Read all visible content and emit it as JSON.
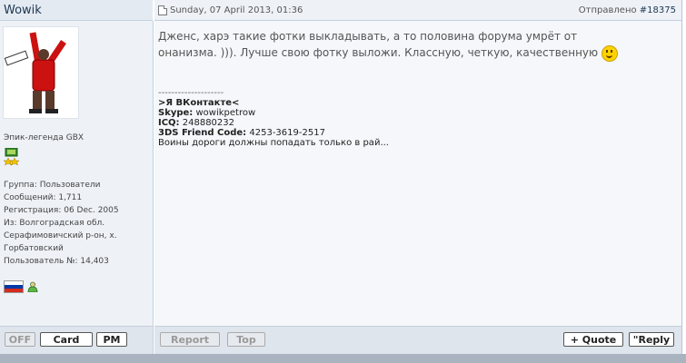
{
  "post": {
    "author": "Wowik",
    "date": "Sunday, 07 April 2013, 01:36",
    "sent_label": "Отправлено",
    "post_number": "#18375"
  },
  "profile": {
    "rank": "Эпик-легенда GBX",
    "info": [
      "Группа: Пользователи",
      "Сообщений: 1,711",
      "Регистрация: 06 Dec. 2005",
      "Из: Волгоградская обл.",
      "Серафимовичский р-он, х.",
      "Горбатовский",
      "Пользователь №: 14,403"
    ],
    "flag_colors": [
      "#ffffff",
      "#0039a6",
      "#d52b1e"
    ]
  },
  "message": {
    "text": "Дженс, харэ такие фотки выкладывать, а то половина форума умрёт от онанизма. ))). Лучше свою фотку выложи. Классную, четкую, качественную",
    "smile_icon": "smile-icon"
  },
  "signature": {
    "separator": "--------------------",
    "vk": ">Я ВКонтакте<",
    "skype_label": "Skype:",
    "skype_value": "wowikpetrow",
    "icq_label": "ICQ:",
    "icq_value": "248880232",
    "fc_label": "3DS Friend Code:",
    "fc_value": "4253-3619-2517",
    "quote": "Воины дороги должны попадать только в рай..."
  },
  "buttons": {
    "off": "OFF",
    "card": "Card",
    "pm": "PM",
    "report": "Report",
    "top": "Top",
    "quote": "+ Quote",
    "reply": "\"Reply"
  }
}
